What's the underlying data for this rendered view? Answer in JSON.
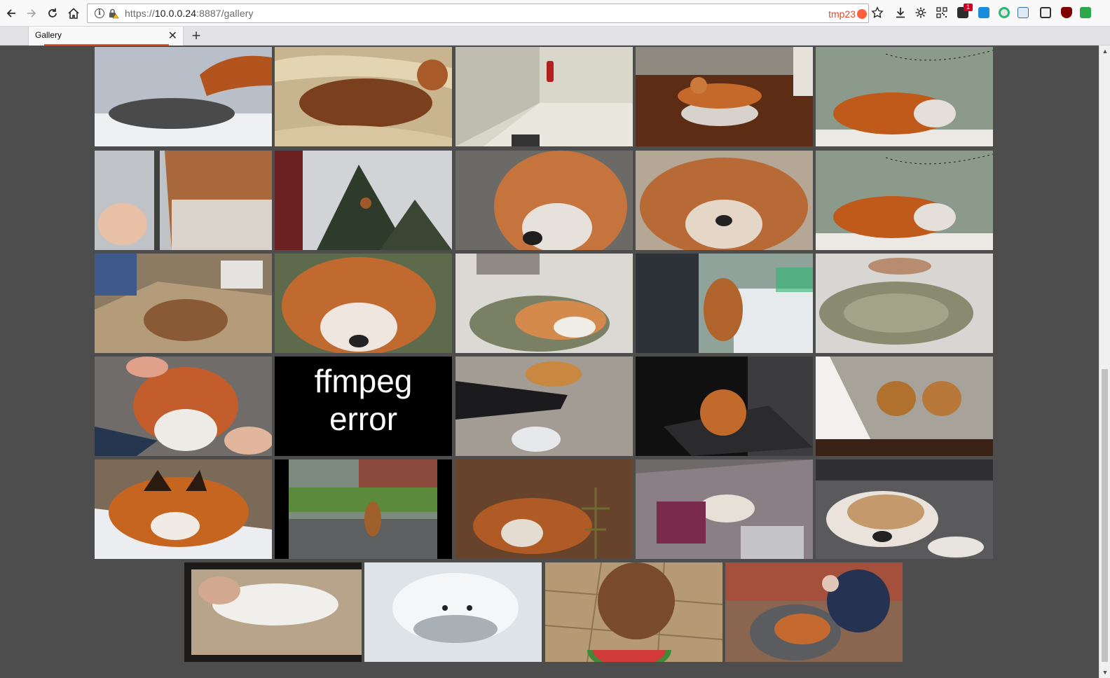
{
  "browser": {
    "url": {
      "scheme": "https://",
      "host": "10.0.0.24",
      "port_path": ":8887/gallery"
    },
    "container_label": "tmp23",
    "notification_badge": "1",
    "tab": {
      "title": "Gallery"
    }
  },
  "gallery": {
    "error_tile_text": [
      "ffmpeg",
      "error"
    ]
  },
  "colors": {
    "page_background": "#4d4d4d",
    "tab_accent": "#e8582c",
    "container_accent": "#ff613d"
  },
  "icons": [
    "back-icon",
    "forward-icon",
    "reload-icon",
    "home-icon",
    "info-icon",
    "lock-warning-icon",
    "star-icon",
    "download-icon",
    "gear-icon",
    "close-tab-icon",
    "new-tab-icon"
  ]
}
